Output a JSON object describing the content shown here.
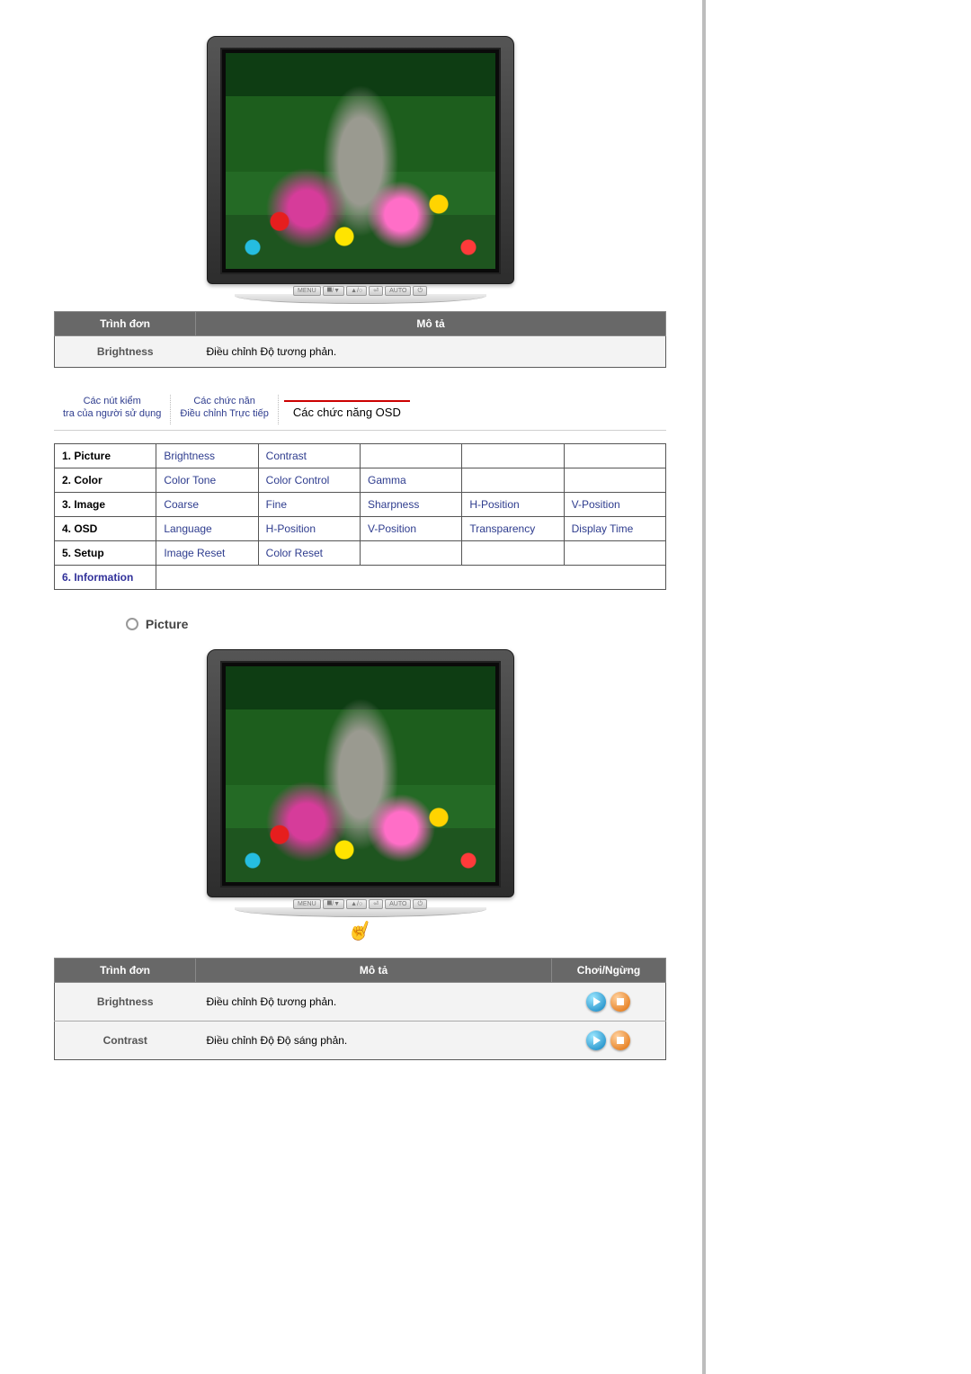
{
  "monitor_buttons": [
    "MENU",
    "⯀/▼",
    "▲/○",
    "⏎",
    "AUTO",
    "⏻"
  ],
  "table1": {
    "headers": [
      "Trình đơn",
      "Mô tả"
    ],
    "rows": [
      {
        "label": "Brightness",
        "desc": "Điều chỉnh Độ tương phản."
      }
    ]
  },
  "tabs": [
    {
      "text": "Các nút kiểm\ntra của người sử dụng"
    },
    {
      "text": "Các chức năn\nĐiều chỉnh Trực tiếp"
    },
    {
      "text": "Các chức năng OSD",
      "active": true
    }
  ],
  "menu_grid": {
    "rows": [
      {
        "cat": "1. Picture",
        "items": [
          "Brightness",
          "Contrast",
          "",
          "",
          ""
        ]
      },
      {
        "cat": "2. Color",
        "items": [
          "Color Tone",
          "Color Control",
          "Gamma",
          "",
          ""
        ]
      },
      {
        "cat": "3. Image",
        "items": [
          "Coarse",
          "Fine",
          "Sharpness",
          "H-Position",
          "V-Position"
        ]
      },
      {
        "cat": "4. OSD",
        "items": [
          "Language",
          "H-Position",
          "V-Position",
          "Transparency",
          "Display Time"
        ]
      },
      {
        "cat": "5. Setup",
        "items": [
          "Image Reset",
          "Color Reset",
          "",
          "",
          ""
        ]
      },
      {
        "cat": "6. Information",
        "active": true,
        "items": [
          "",
          "",
          "",
          "",
          ""
        ]
      }
    ]
  },
  "section_title": "Picture",
  "table2": {
    "headers": [
      "Trình đơn",
      "Mô tả",
      "Chơi/Ngừng"
    ],
    "rows": [
      {
        "label": "Brightness",
        "desc": "Điều chỉnh Độ tương phản."
      },
      {
        "label": "Contrast",
        "desc": "Điều chỉnh Độ Độ sáng phản."
      }
    ]
  }
}
